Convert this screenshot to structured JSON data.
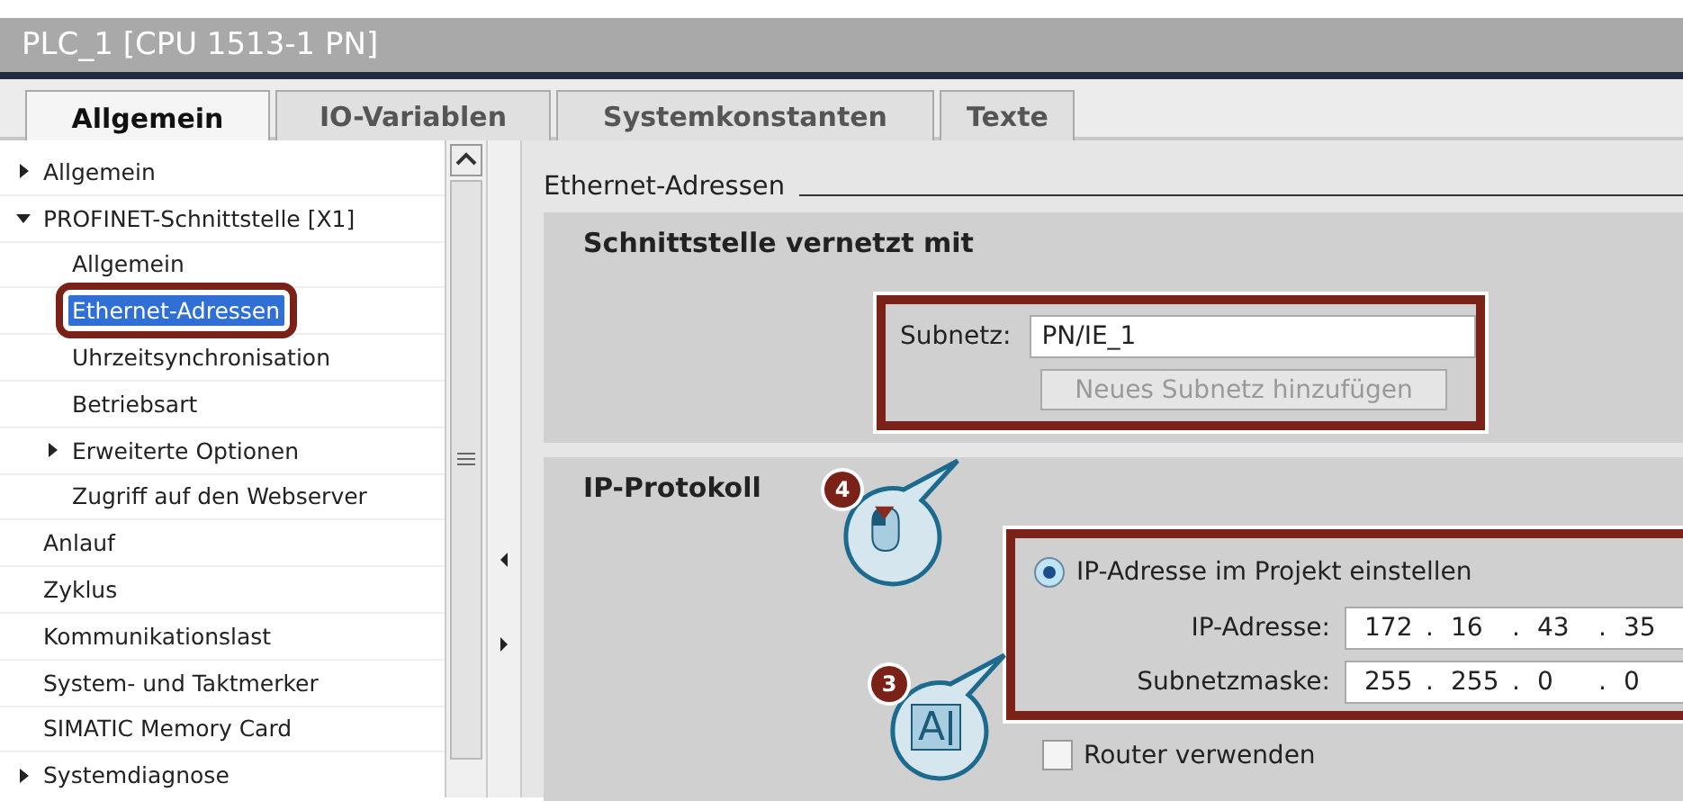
{
  "window": {
    "title": "PLC_1 [CPU 1513-1 PN]"
  },
  "tabs": [
    {
      "label": "Allgemein",
      "selected": true
    },
    {
      "label": "IO-Variablen",
      "selected": false
    },
    {
      "label": "Systemkonstanten",
      "selected": false
    },
    {
      "label": "Texte",
      "selected": false
    }
  ],
  "tree": [
    {
      "label": "Allgemein",
      "kind": "group",
      "expanded": false,
      "selected": false
    },
    {
      "label": "PROFINET-Schnittstelle [X1]",
      "kind": "group",
      "expanded": true,
      "selected": false,
      "children": [
        {
          "label": "Allgemein",
          "kind": "leaf",
          "selected": false
        },
        {
          "label": "Ethernet-Adressen",
          "kind": "leaf",
          "selected": true
        },
        {
          "label": "Uhrzeitsynchronisation",
          "kind": "leaf",
          "selected": false
        },
        {
          "label": "Betriebsart",
          "kind": "leaf",
          "selected": false
        },
        {
          "label": "Erweiterte Optionen",
          "kind": "group",
          "expanded": false,
          "selected": false
        },
        {
          "label": "Zugriff auf den Webserver",
          "kind": "leaf",
          "selected": false
        }
      ]
    },
    {
      "label": "Anlauf",
      "kind": "leaf",
      "selected": false
    },
    {
      "label": "Zyklus",
      "kind": "leaf",
      "selected": false
    },
    {
      "label": "Kommunikationslast",
      "kind": "leaf",
      "selected": false
    },
    {
      "label": "System- und Taktmerker",
      "kind": "leaf",
      "selected": false
    },
    {
      "label": "SIMATIC Memory Card",
      "kind": "leaf",
      "selected": false
    },
    {
      "label": "Systemdiagnose",
      "kind": "group",
      "expanded": false,
      "selected": false
    }
  ],
  "content": {
    "heading": "Ethernet-Adressen",
    "interface_section": {
      "title": "Schnittstelle vernetzt mit",
      "subnet_label": "Subnetz:",
      "subnet_value": "PN/IE_1",
      "add_button": {
        "label": "Neues Subnetz hinzufügen",
        "disabled": true
      }
    },
    "ip_section": {
      "title": "IP-Protokoll",
      "radio": {
        "label": "IP-Adresse im Projekt einstellen",
        "selected": true
      },
      "fields": [
        {
          "label": "IP-Adresse:",
          "separator": ".",
          "octets": [
            "172",
            "16",
            "43",
            "35"
          ]
        },
        {
          "label": "Subnetzmaske:",
          "separator": ".",
          "octets": [
            "255",
            "255",
            "0",
            "0"
          ]
        }
      ],
      "router": {
        "label": "Router verwenden",
        "checked": false
      }
    }
  },
  "callouts": [
    {
      "number": "4",
      "kind": "mouse"
    },
    {
      "number": "3",
      "kind": "text",
      "glyph": "A"
    }
  ]
}
